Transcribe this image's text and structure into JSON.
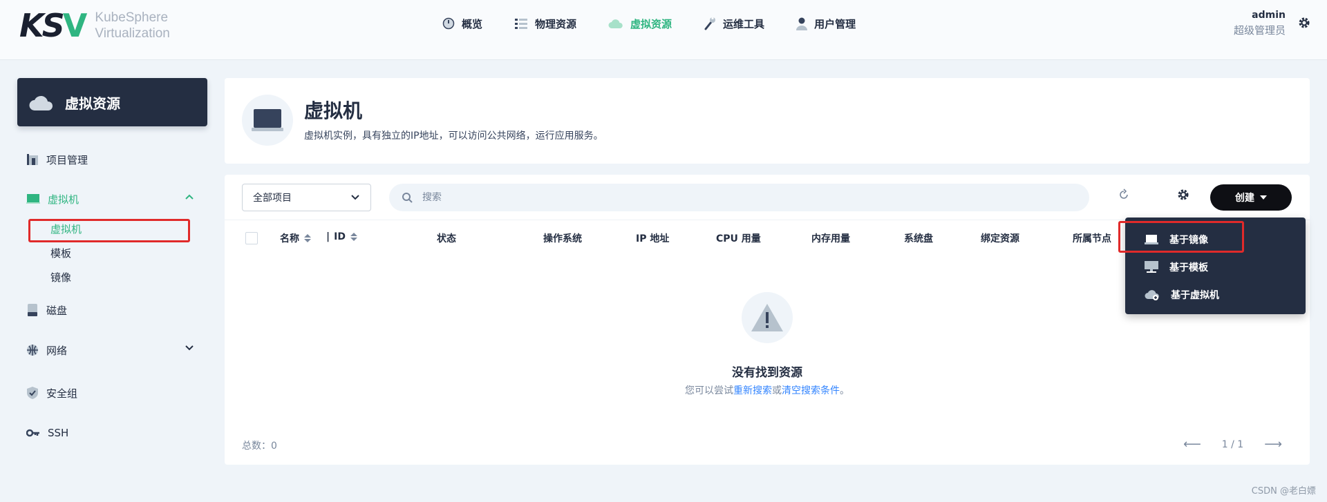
{
  "brand": {
    "logo_mark": "KSV",
    "line1": "KubeSphere",
    "line2": "Virtualization"
  },
  "nav": [
    {
      "label": "概览",
      "icon": "dashboard-icon"
    },
    {
      "label": "物理资源",
      "icon": "list-icon"
    },
    {
      "label": "虚拟资源",
      "icon": "cloud-icon",
      "active": true
    },
    {
      "label": "运维工具",
      "icon": "wrench-icon"
    },
    {
      "label": "用户管理",
      "icon": "user-icon"
    }
  ],
  "user": {
    "name": "admin",
    "role": "超级管理员"
  },
  "sidebar": {
    "title": "虚拟资源",
    "items": [
      {
        "label": "项目管理"
      },
      {
        "label": "虚拟机"
      },
      {
        "label": "磁盘"
      },
      {
        "label": "网络"
      },
      {
        "label": "安全组"
      },
      {
        "label": "SSH"
      }
    ],
    "vm_sub": [
      {
        "label": "虚拟机"
      },
      {
        "label": "模板"
      },
      {
        "label": "镜像"
      }
    ]
  },
  "banner": {
    "title": "虚拟机",
    "description": "虚拟机实例，具有独立的IP地址，可以访问公共网络，运行应用服务。"
  },
  "toolbar": {
    "project_select": "全部项目",
    "search_placeholder": "搜索",
    "create_label": "创建"
  },
  "table": {
    "columns": [
      "名称",
      "ID",
      "状态",
      "操作系统",
      "IP 地址",
      "CPU 用量",
      "内存用量",
      "系统盘",
      "绑定资源",
      "所属节点"
    ],
    "id_separator": "|"
  },
  "empty": {
    "title": "没有找到资源",
    "desc_prefix": "您可以尝试",
    "link1": "重新搜索",
    "desc_mid": "或",
    "link2": "清空搜索条件",
    "desc_suffix": "。"
  },
  "footer": {
    "total": "总数：0",
    "page": "1 / 1"
  },
  "create_menu": [
    {
      "label": "基于镜像"
    },
    {
      "label": "基于模板"
    },
    {
      "label": "基于虚拟机"
    }
  ],
  "watermark": "CSDN @老白嫖",
  "colors": {
    "accent": "#2fb581",
    "dark": "#242e42",
    "highlight": "#e02a2a",
    "link": "#3385ff"
  }
}
